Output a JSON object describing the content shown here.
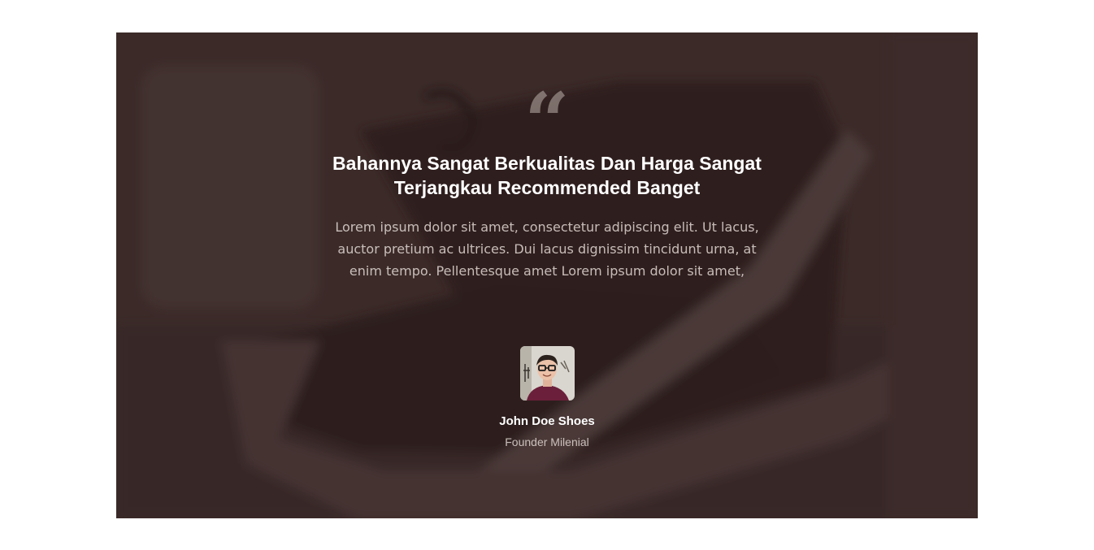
{
  "testimonial": {
    "quote_icon": "quote-left-icon",
    "quote_glyph": "“",
    "headline": "Bahannya Sangat Berkualitas Dan Harga Sangat Terjangkau Recommended Banget",
    "body": "Lorem ipsum dolor sit amet, consectetur adipiscing elit. Ut lacus, auctor pretium ac ultrices. Dui lacus dignissim tincidunt urna, at enim tempo. Pellentesque amet Lorem ipsum dolor sit amet,",
    "author": {
      "name": "John Doe Shoes",
      "role": "Founder Milenial"
    }
  },
  "colors": {
    "overlay": "#30201f",
    "background": "#3d2b2a",
    "text_primary": "#ffffff"
  }
}
